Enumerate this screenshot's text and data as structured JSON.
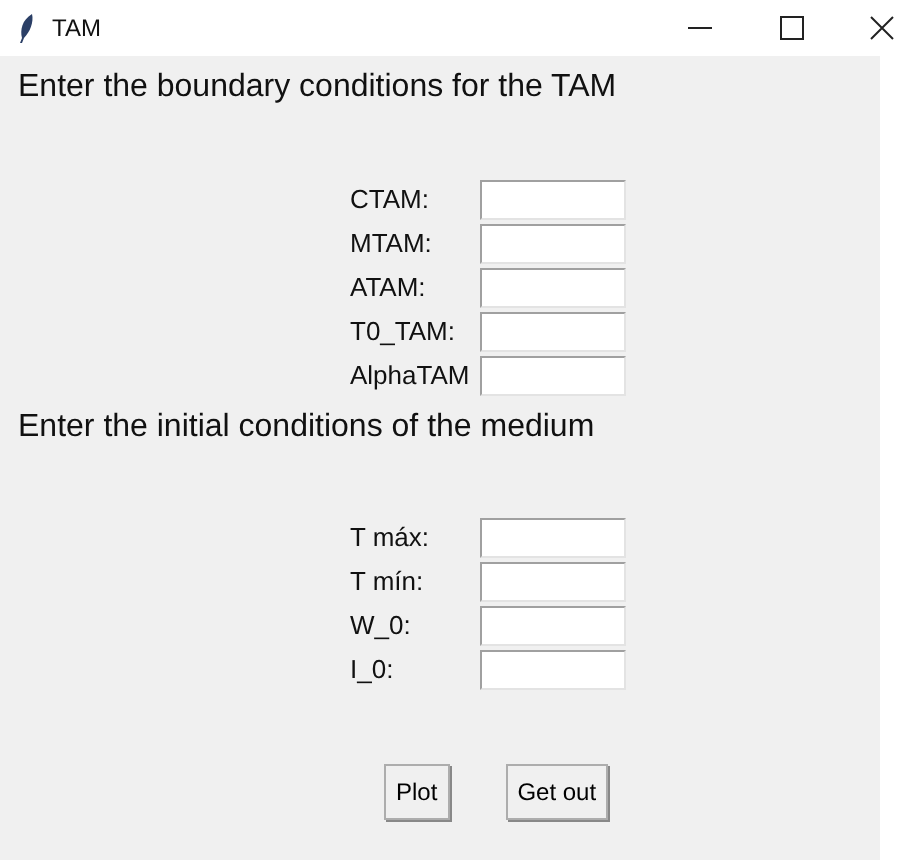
{
  "window": {
    "title": "TAM"
  },
  "sections": [
    {
      "heading": "Enter the boundary conditions for the TAM",
      "fields": [
        {
          "label": "CTAM:"
        },
        {
          "label": "MTAM:"
        },
        {
          "label": "ATAM:"
        },
        {
          "label": "T0_TAM:"
        },
        {
          "label": "AlphaTAM"
        }
      ]
    },
    {
      "heading": "Enter the initial conditions of the medium",
      "fields": [
        {
          "label": "T máx:"
        },
        {
          "label": "T mín:"
        },
        {
          "label": "W_0:"
        },
        {
          "label": "I_0:"
        }
      ]
    }
  ],
  "buttons": [
    "Plot",
    "Get out"
  ]
}
